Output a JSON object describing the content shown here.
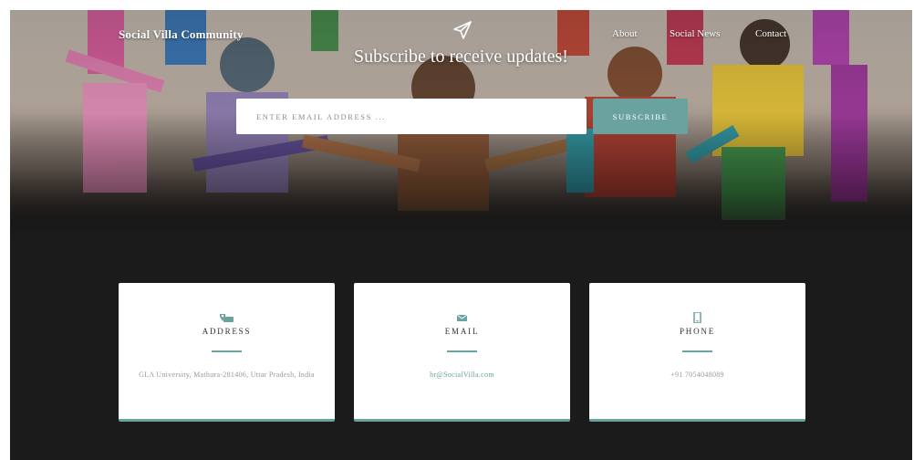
{
  "header": {
    "brand": "Social Villa Community",
    "nav": [
      "About",
      "Social News",
      "Contact"
    ]
  },
  "subscribe": {
    "headline": "Subscribe to receive updates!",
    "email_placeholder": "ENTER EMAIL ADDRESS ...",
    "button_label": "SUBSCRIBE"
  },
  "contact_cards": [
    {
      "title": "ADDRESS",
      "icon": "map-marker-icon",
      "value": "GLA University, Mathura-281406, Uttar Pradesh, India"
    },
    {
      "title": "EMAIL",
      "icon": "envelope-icon",
      "value": "hr@SocialVilla.com"
    },
    {
      "title": "PHONE",
      "icon": "mobile-phone-icon",
      "value": "+91 7054048089"
    }
  ],
  "colors": {
    "accent": "#69a29e",
    "background": "#1b1b1b"
  }
}
